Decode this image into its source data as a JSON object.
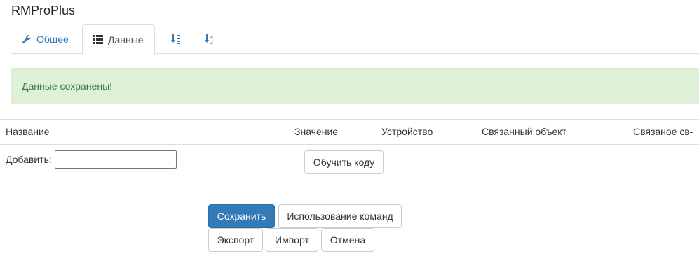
{
  "app": {
    "title": "RMProPlus"
  },
  "tabs": {
    "general": {
      "label": "Общее",
      "icon": "wrench-icon"
    },
    "data": {
      "label": "Данные",
      "icon": "list-icon"
    },
    "sort_asc": {
      "icon": "sort-numeric-asc-icon"
    },
    "sort_desc": {
      "icon": "sort-alpha-desc-icon"
    }
  },
  "alert": {
    "message": "Данные сохранены!"
  },
  "table": {
    "columns": [
      "Название",
      "Значение",
      "Устройство",
      "Связанный объект",
      "Связаное св-"
    ]
  },
  "add_row": {
    "label": "Добавить:",
    "value": "",
    "learn_button": "Обучить коду"
  },
  "actions": {
    "save": "Сохранить",
    "usage": "Использование команд",
    "export": "Экспорт",
    "import": "Импорт",
    "cancel": "Отмена"
  },
  "colors": {
    "primary": "#337ab7",
    "success_bg": "#dff0d8",
    "success_text": "#3c763d",
    "border": "#dddddd"
  }
}
